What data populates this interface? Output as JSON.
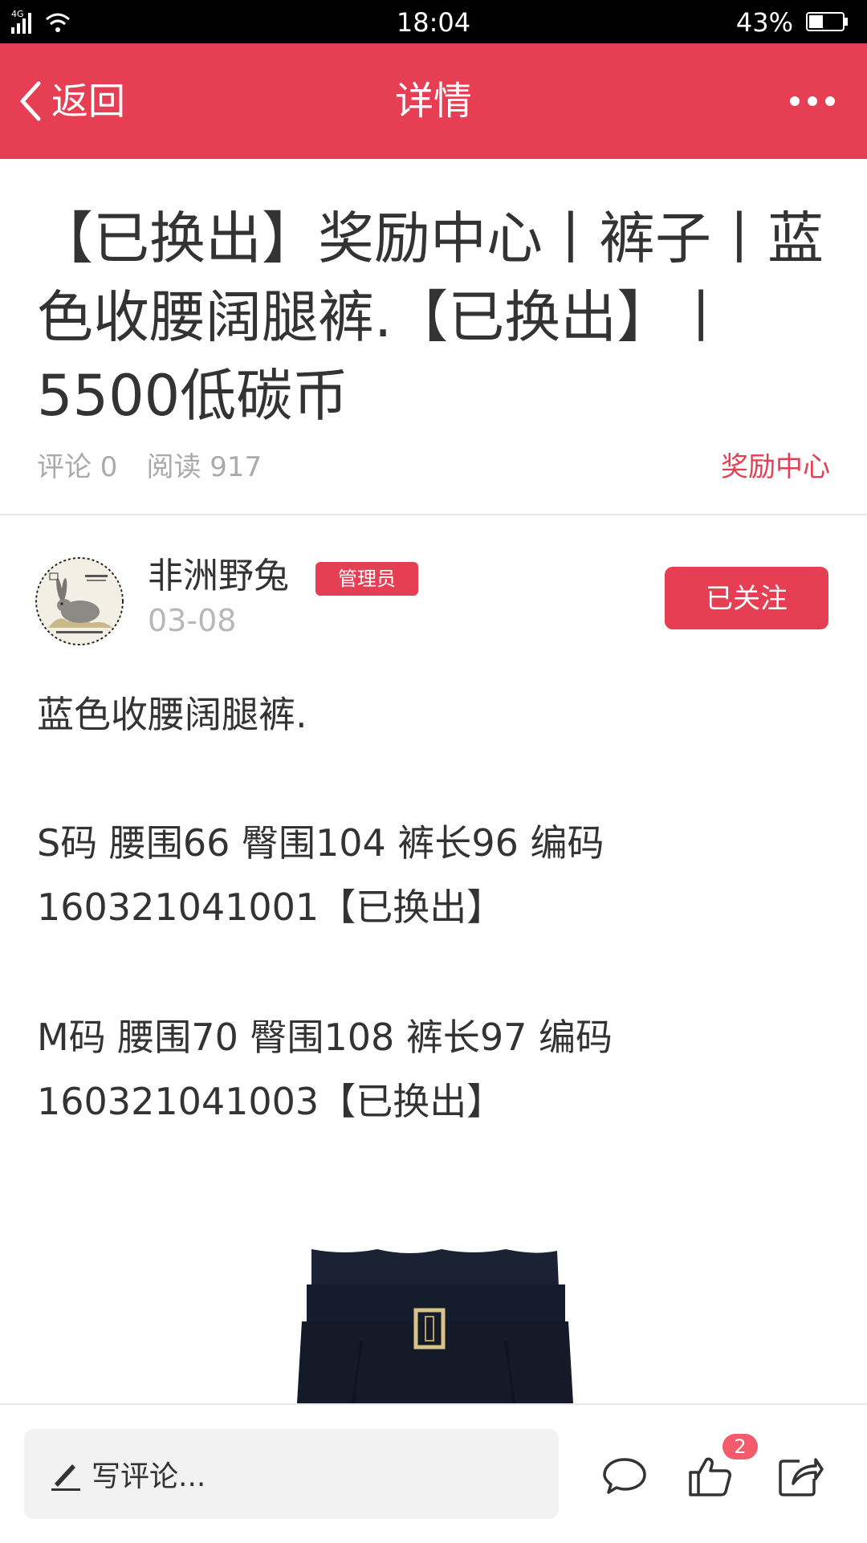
{
  "status_bar": {
    "time": "18:04",
    "battery_percent": "43%",
    "network": "4G",
    "battery_level": 0.43
  },
  "nav": {
    "back_label": "返回",
    "title": "详情"
  },
  "article": {
    "title": "【已换出】奖励中心丨裤子丨蓝色收腰阔腿裤.【已换出】丨5500低碳币",
    "comments_label": "评论 0",
    "reads_label": "阅读 917",
    "category": "奖励中心"
  },
  "author": {
    "name": "非洲野兔",
    "badge": "管理员",
    "date": "03-08",
    "follow_label": "已关注"
  },
  "content": {
    "intro": "蓝色收腰阔腿裤.",
    "size_s": "S码  腰围66  臀围104  裤长96    编码160321041001【已换出】",
    "size_m": "M码  腰围70  臀围108  裤长97    编码160321041003【已换出】"
  },
  "bottom_bar": {
    "comment_placeholder": "写评论...",
    "like_count": "2"
  },
  "colors": {
    "accent": "#e63e52",
    "status_bar": "#000000",
    "muted_text": "#aaaaaa"
  },
  "icons": [
    "back-chevron-icon",
    "more-icon",
    "pen-icon",
    "comment-icon",
    "like-icon",
    "share-icon"
  ]
}
